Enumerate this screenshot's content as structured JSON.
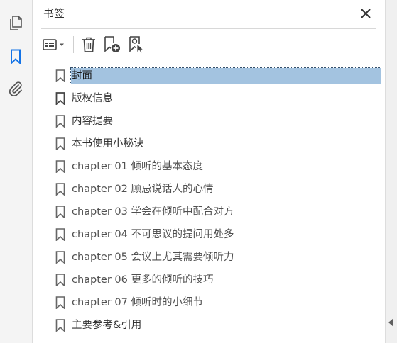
{
  "panel": {
    "title": "书签"
  },
  "sidebar": {
    "icons": [
      "pages-icon",
      "bookmark-icon",
      "attachments-icon"
    ],
    "active": "bookmark-icon",
    "accent_color": "#1473e6"
  },
  "toolbar": {
    "buttons": [
      "options-menu-icon",
      "delete-icon",
      "new-bookmark-icon",
      "new-bookmark-from-structure-icon"
    ]
  },
  "bookmarks": {
    "selected_index": 0,
    "selection_color": "#a3c3e0",
    "items": [
      "封面",
      "版权信息",
      "内容提要",
      "本书使用小秘诀",
      "chapter 01 倾听的基本态度",
      "chapter 02 顾忌说话人的心情",
      "chapter 03 学会在倾听中配合对方",
      "chapter 04 不可思议的提问用处多",
      "chapter 05 会议上尤其需要倾听力",
      "chapter 06 更多的倾听的技巧",
      "chapter 07 倾听时的小细节",
      "主要参考&引用"
    ]
  }
}
